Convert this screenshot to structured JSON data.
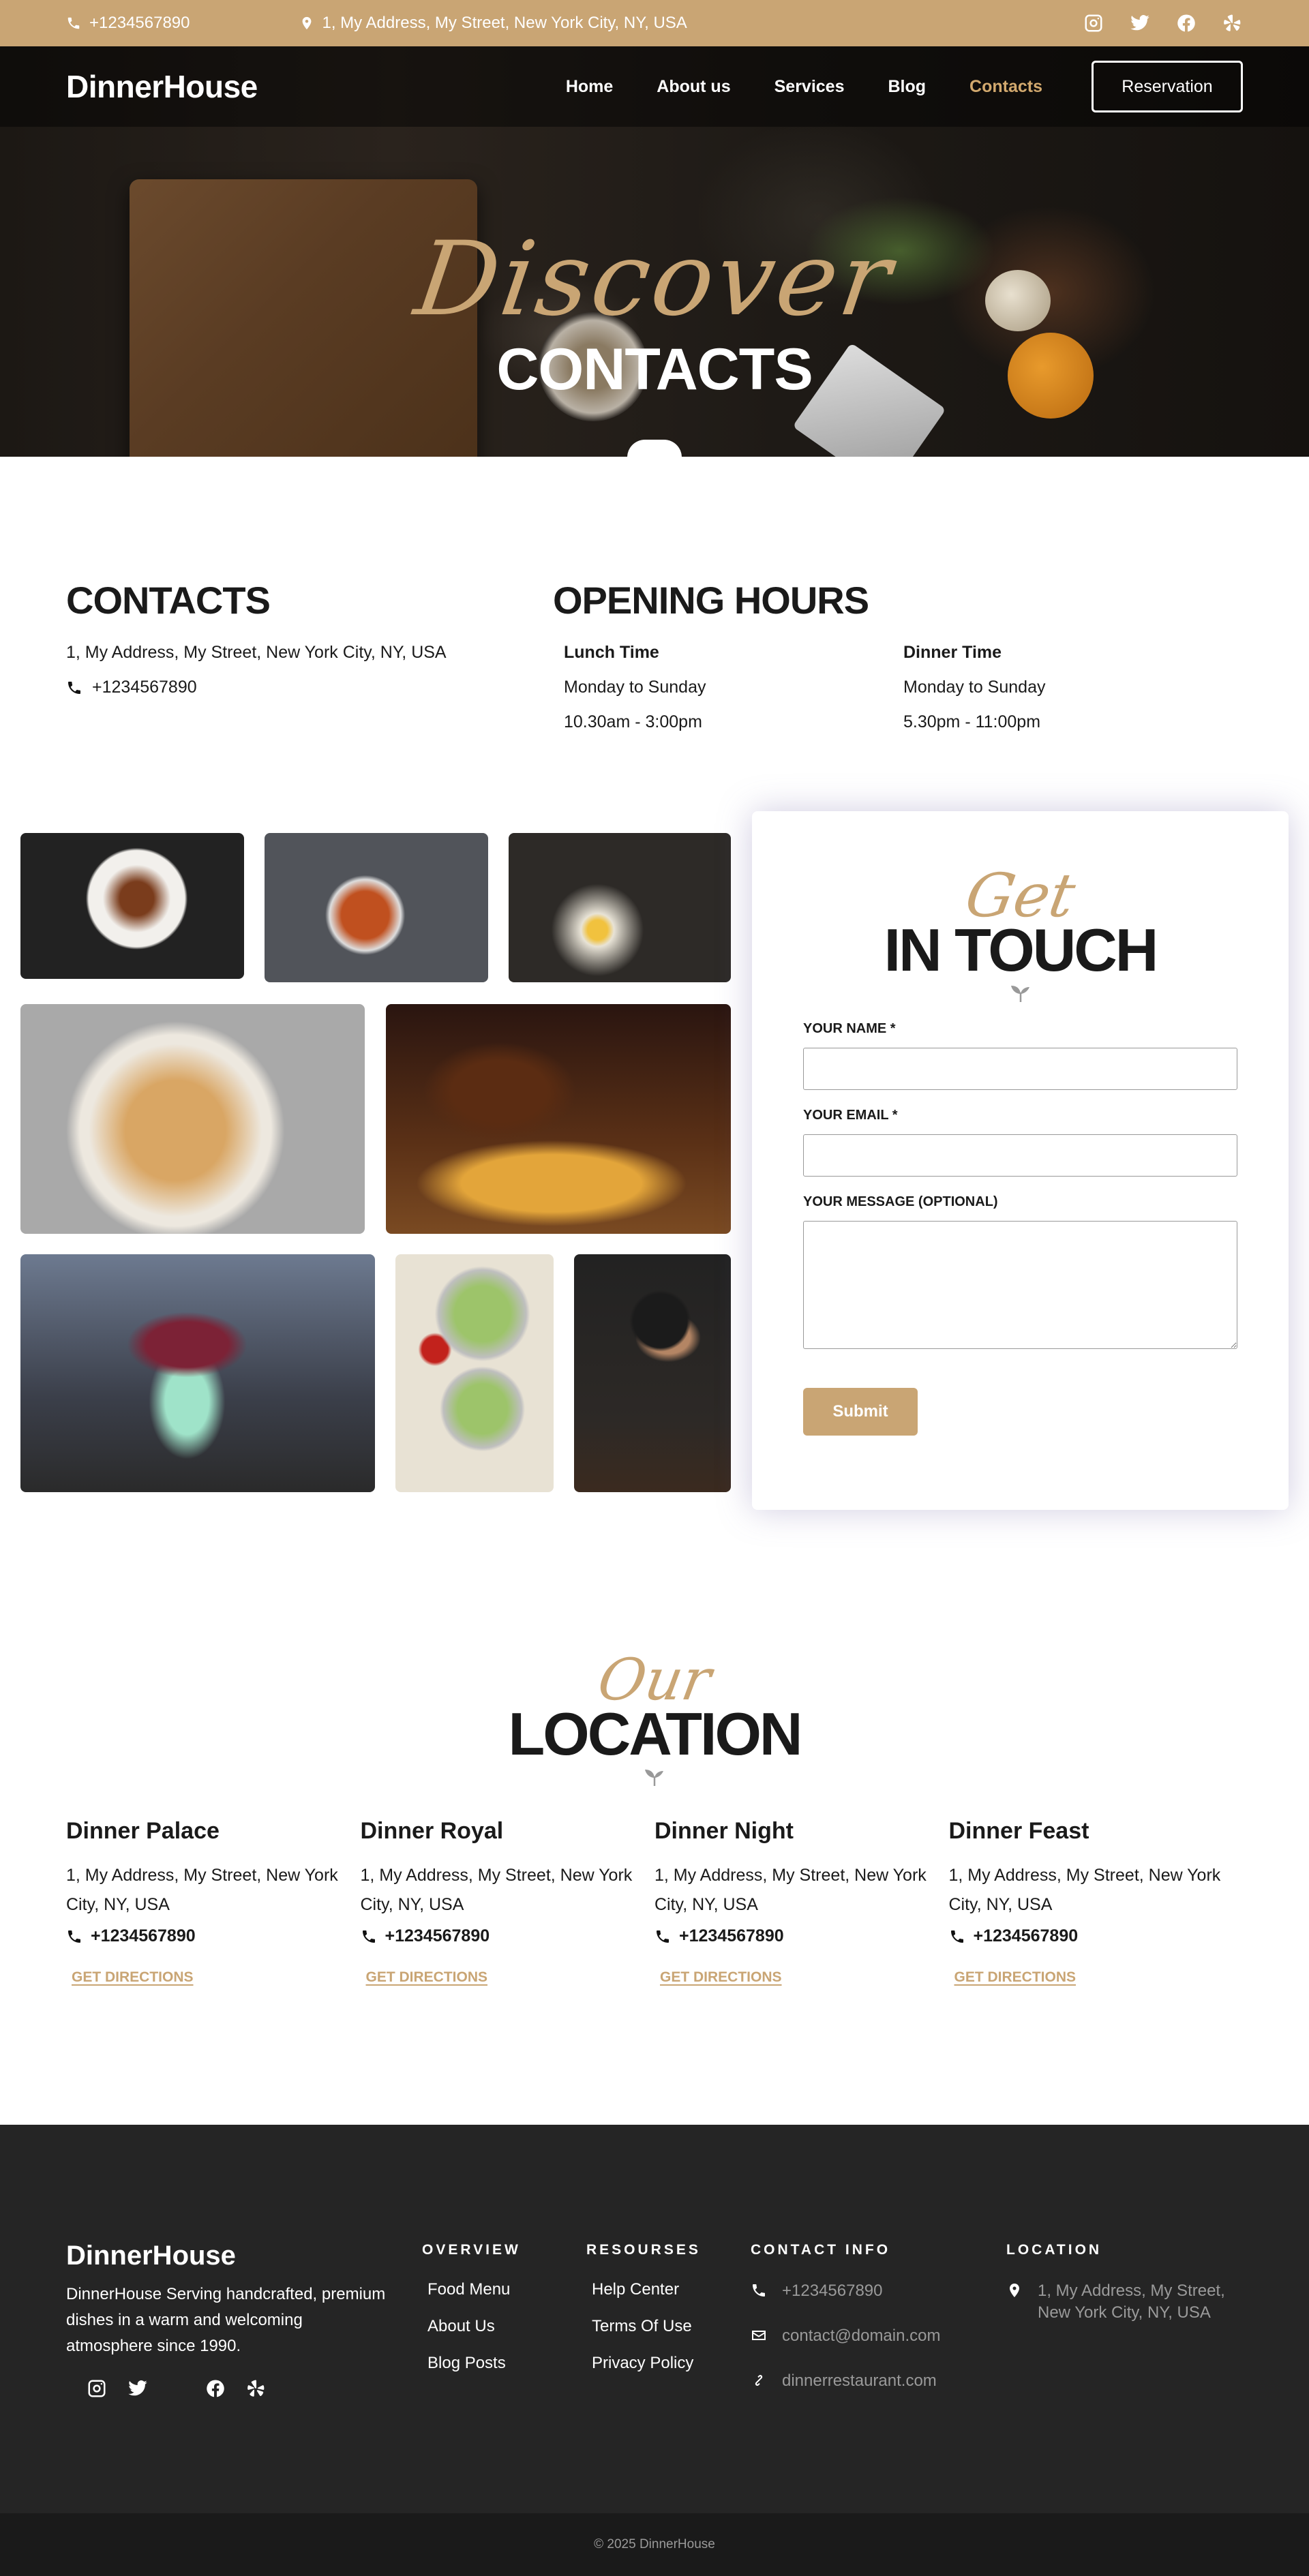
{
  "topbar": {
    "phone": "+1234567890",
    "address": "1, My Address, My Street, New York City, NY, USA",
    "social_icons": [
      "instagram-icon",
      "twitter-icon",
      "facebook-icon",
      "yelp-icon"
    ]
  },
  "nav": {
    "logo": "DinnerHouse",
    "items": [
      {
        "label": "Home",
        "active": false
      },
      {
        "label": "About us",
        "active": false
      },
      {
        "label": "Services",
        "active": false
      },
      {
        "label": "Blog",
        "active": false
      },
      {
        "label": "Contacts",
        "active": true
      }
    ],
    "reservation": "Reservation"
  },
  "hero": {
    "script": "Discover",
    "title": "CONTACTS"
  },
  "contacts": {
    "title": "CONTACTS",
    "address": "1, My Address, My Street, New York City, NY, USA",
    "phone": "+1234567890"
  },
  "hours": {
    "title": "OPENING HOURS",
    "lunch": {
      "label": "Lunch Time",
      "days": "Monday to Sunday",
      "time": "10.30am - 3:00pm"
    },
    "dinner": {
      "label": "Dinner Time",
      "days": "Monday to Sunday",
      "time": "5.30pm - 11:00pm"
    }
  },
  "form": {
    "script": "Get",
    "title": "IN TOUCH",
    "name_label": "YOUR NAME *",
    "email_label": "YOUR EMAIL *",
    "message_label": "YOUR MESSAGE (OPTIONAL)",
    "name_value": "",
    "email_value": "",
    "message_value": "",
    "submit": "Submit"
  },
  "location": {
    "script": "Our",
    "title": "LOCATION",
    "places": [
      {
        "name": "Dinner Palace",
        "address": "1, My Address, My Street, New York City, NY, USA",
        "phone": "+1234567890",
        "link": "GET DIRECTIONS"
      },
      {
        "name": "Dinner Royal",
        "address": "1, My Address, My Street, New York City, NY, USA",
        "phone": "+1234567890",
        "link": "GET DIRECTIONS"
      },
      {
        "name": "Dinner Night",
        "address": "1, My Address, My Street, New York City, NY, USA",
        "phone": "+1234567890",
        "link": "GET DIRECTIONS"
      },
      {
        "name": "Dinner Feast",
        "address": "1, My Address, My Street, New York City, NY, USA",
        "phone": "+1234567890",
        "link": "GET DIRECTIONS"
      }
    ]
  },
  "footer": {
    "logo": "DinnerHouse",
    "description": "DinnerHouse Serving handcrafted, premium dishes in a warm and welcoming atmosphere since 1990.",
    "overview": {
      "title": "OVERVIEW",
      "links": [
        "Food Menu",
        "About Us",
        "Blog Posts"
      ]
    },
    "resources": {
      "title": "RESOURSES",
      "links": [
        "Help Center",
        "Terms Of Use",
        "Privacy Policy"
      ]
    },
    "contact": {
      "title": "CONTACT INFO",
      "phone": "+1234567890",
      "email": "contact@domain.com",
      "website": "dinnerrestaurant.com"
    },
    "location": {
      "title": "LOCATION",
      "address": "1, My Address, My Street, New York City, NY, USA"
    },
    "copyright": "© 2025 DinnerHouse"
  },
  "colors": {
    "accent": "#c9a574",
    "dark": "#252525",
    "darker": "#1a1a1a"
  }
}
